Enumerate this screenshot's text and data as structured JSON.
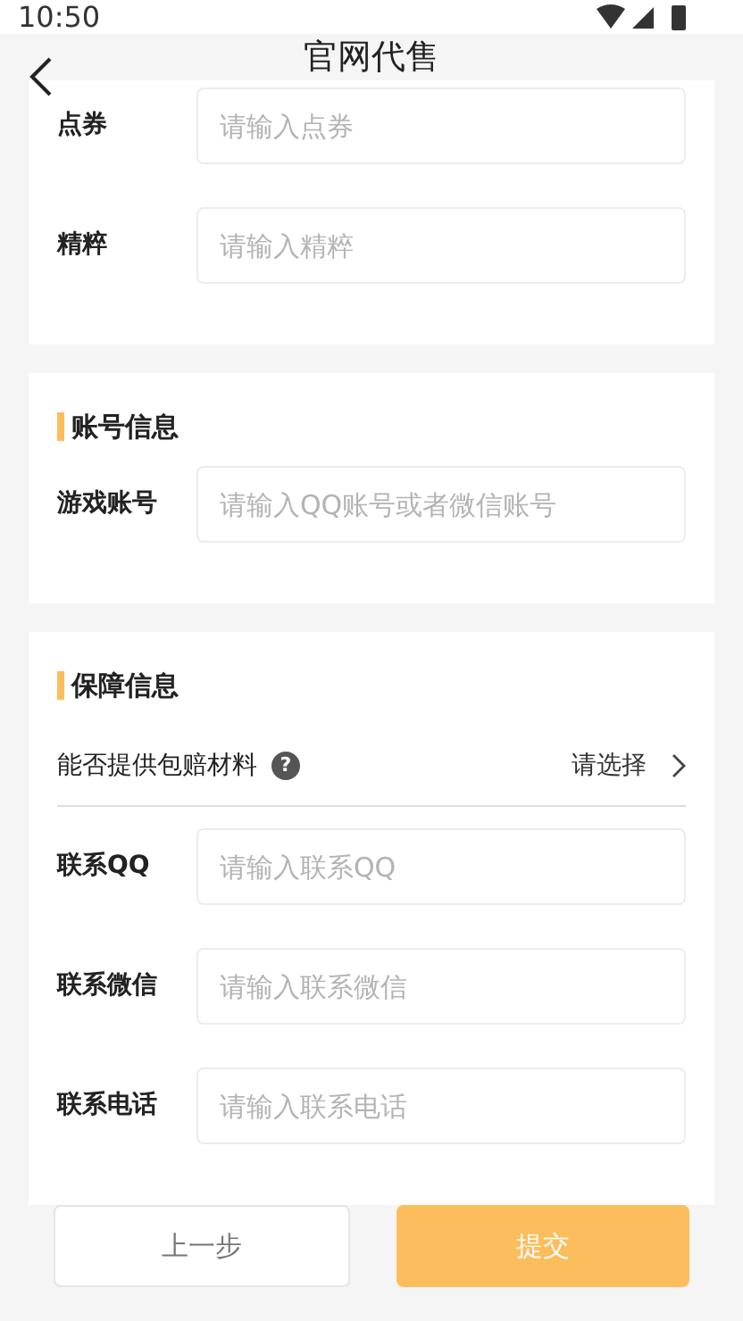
{
  "status_bar": {
    "time": "10:50"
  },
  "header": {
    "title": "官网代售"
  },
  "sections": [
    {
      "fields": [
        {
          "kind": "input",
          "label": "点券",
          "placeholder": "请输入点券"
        },
        {
          "kind": "input",
          "label": "精粹",
          "placeholder": "请输入精粹"
        }
      ]
    },
    {
      "title": "账号信息",
      "fields": [
        {
          "kind": "input",
          "label": "游戏账号",
          "placeholder": "请输入QQ账号或者微信账号"
        }
      ]
    },
    {
      "title": "保障信息",
      "fields": [
        {
          "kind": "select",
          "label": "能否提供包赔材料",
          "help": "?",
          "value": "请选择"
        },
        {
          "kind": "input",
          "label": "联系QQ",
          "placeholder": "请输入联系QQ"
        },
        {
          "kind": "input",
          "label": "联系微信",
          "placeholder": "请输入联系微信"
        },
        {
          "kind": "input",
          "label": "联系电话",
          "placeholder": "请输入联系电话"
        }
      ]
    }
  ],
  "buttons": [
    {
      "kind": "secondary",
      "label": "上一步"
    },
    {
      "kind": "primary",
      "label": "提交"
    }
  ]
}
